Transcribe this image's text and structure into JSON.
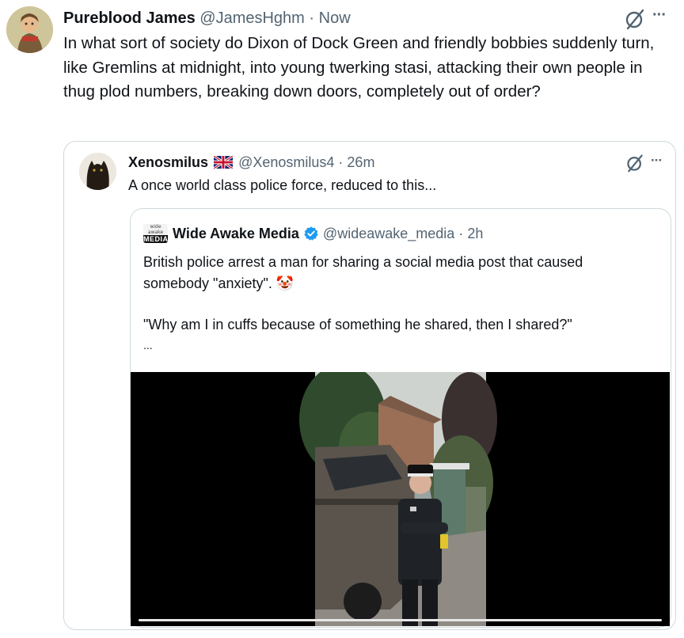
{
  "main_tweet": {
    "display_name": "Pureblood James",
    "handle": "@JamesHghm",
    "separator": "·",
    "time": "Now",
    "text": "In what sort of society do Dixon of Dock Green and friendly bobbies suddenly turn, like Gremlins at midnight, into young twerking stasi, attacking their own people in thug plod numbers, breaking down doors, completely out of order?",
    "more_label": "···",
    "avatar_icon": "cartoon-avatar-icon",
    "grok_icon": "slashed-circle-icon"
  },
  "quoted_tweet": {
    "display_name": "Xenosmilus",
    "flag": "uk-flag-icon",
    "handle": "@Xenosmilus4",
    "separator": "·",
    "time": "26m",
    "text": "A once world class police force, reduced to this...",
    "more_label": "···",
    "grok_icon": "slashed-circle-icon"
  },
  "nested_quote": {
    "display_name": "Wide Awake Media",
    "avatar_label": "MEDIA",
    "avatar_small_label": "wide awake",
    "handle": "@wideawake_media",
    "separator": "·",
    "time": "2h",
    "text_line1": "British police arrest a man for sharing a social media post that caused",
    "text_line2": "somebody \"anxiety\".",
    "emoji": "🤡",
    "quote_text": "\"Why am I in cuffs because of something he shared, then I shared?\"",
    "ellipsis": "...",
    "verified_color": "#1d9bf0"
  },
  "colors": {
    "text": "#0f1419",
    "muted": "#536471",
    "border": "#cfd9de",
    "video_bg": "#000000"
  }
}
